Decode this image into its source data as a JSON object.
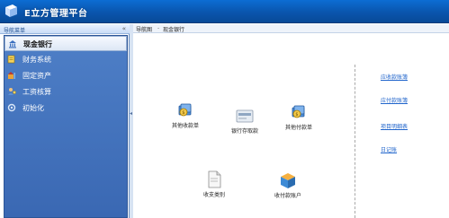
{
  "app": {
    "title": "E立方管理平台",
    "colors": {
      "titlebar": "#0a5fc2",
      "nav": "#4a78c0",
      "link": "#2266cc"
    }
  },
  "nav": {
    "header": "导航菜单",
    "collapse_icon": "«",
    "items": [
      {
        "label": "现金银行",
        "icon": "bank-icon",
        "active": true
      },
      {
        "label": "财务系统",
        "icon": "ledger-icon",
        "active": false
      },
      {
        "label": "固定资产",
        "icon": "asset-icon",
        "active": false
      },
      {
        "label": "工资核算",
        "icon": "salary-icon",
        "active": false
      },
      {
        "label": "初始化",
        "icon": "init-icon",
        "active": false
      }
    ]
  },
  "breadcrumb": {
    "root": "导航图",
    "separator": "-",
    "current": "现金银行"
  },
  "flow": {
    "other_receipt": "其他收款单",
    "bank_deposit": "银行存取款",
    "other_payment": "其他付款单",
    "income_expense_category": "收支类别",
    "bank_account": "收付款账户"
  },
  "links": [
    "应收款账簿",
    "应付款账簿",
    "项目明细表",
    "日记账"
  ]
}
